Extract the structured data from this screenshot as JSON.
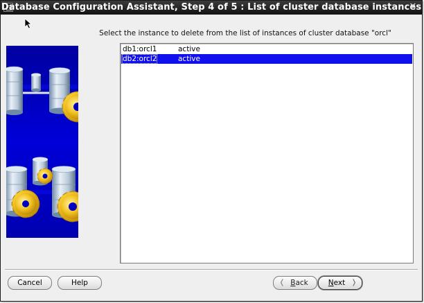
{
  "window": {
    "title": "Database Configuration Assistant, Step 4 of 5 : List of cluster database instances"
  },
  "main": {
    "instruction": "Select the instance to delete from the list of instances of cluster database \"orcl\"",
    "instances": [
      {
        "name": "db1:orcl1",
        "status": "active",
        "selected": false
      },
      {
        "name": "db2:orcl2",
        "status": "active",
        "selected": true
      }
    ]
  },
  "buttons": {
    "cancel": "Cancel",
    "help": "Help",
    "back": "Back",
    "next": "Next"
  },
  "icons": {
    "close": "close-icon",
    "back_chevron": "chevron-left-icon",
    "next_chevron": "chevron-right-icon"
  },
  "colors": {
    "selection": "#1010ee",
    "art_background": "#0000c8",
    "gear": "#f0c020"
  }
}
